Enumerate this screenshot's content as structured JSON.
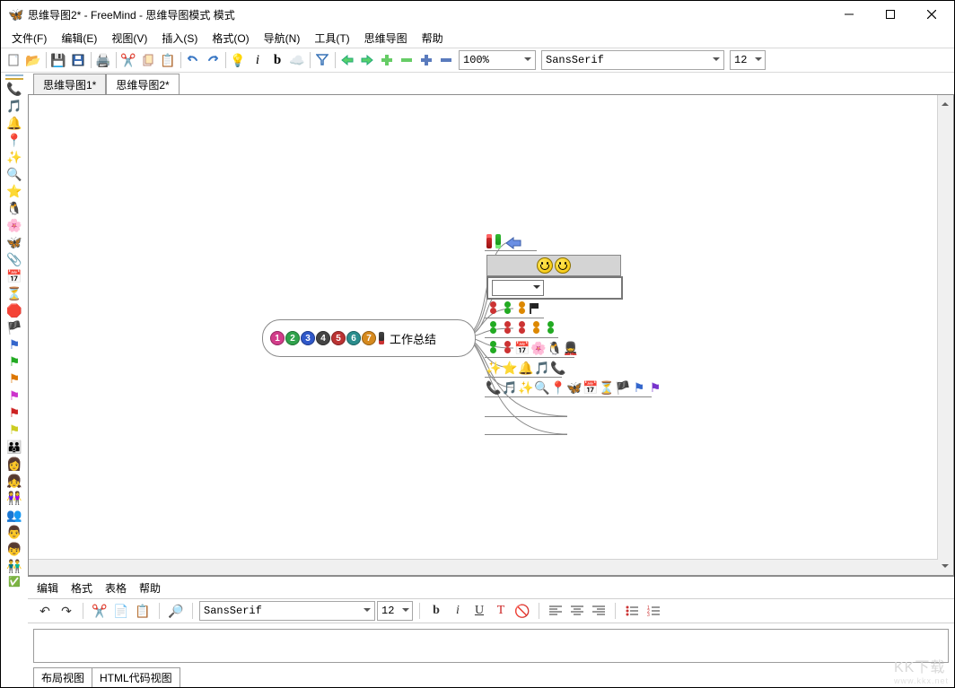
{
  "title": "思维导图2* - FreeMind - 思维导图模式 模式",
  "menus": {
    "file": "文件(F)",
    "edit": "编辑(E)",
    "view": "视图(V)",
    "insert": "插入(S)",
    "format": "格式(O)",
    "nav": "导航(N)",
    "tools": "工具(T)",
    "mindmap": "思维导图",
    "help": "帮助"
  },
  "toolbar": {
    "zoom": "100%",
    "font": "SansSerif",
    "fontsize": "12"
  },
  "tabs": {
    "tab1": "思维导图1*",
    "tab2": "思维导图2*"
  },
  "mindmap": {
    "root_label": "工作总结",
    "numbers": [
      "1",
      "2",
      "3",
      "4",
      "5",
      "6",
      "7"
    ]
  },
  "editor": {
    "menus": {
      "edit": "编辑",
      "format": "格式",
      "table": "表格",
      "help": "帮助"
    },
    "font": "SansSerif",
    "fontsize": "12",
    "tabs": {
      "layout": "布局视图",
      "html": "HTML代码视图"
    }
  },
  "watermark": {
    "big": "KK下载",
    "small": "www.kkx.net"
  }
}
